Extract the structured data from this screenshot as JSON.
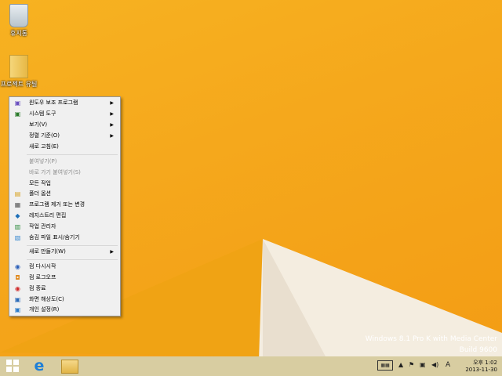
{
  "desktop": {
    "recycle_bin": "휴지통",
    "folder": "프로젝트 유틸"
  },
  "menu": {
    "items": [
      {
        "label": "윈도우 보조 프로그램",
        "submenu": true,
        "disabled": false,
        "icon": "accessories-icon"
      },
      {
        "label": "시스템 도구",
        "submenu": true,
        "disabled": false,
        "icon": "system-tools-icon"
      },
      {
        "label": "보기(V)",
        "submenu": true,
        "disabled": false,
        "icon": ""
      },
      {
        "label": "정렬 기준(O)",
        "submenu": true,
        "disabled": false,
        "icon": ""
      },
      {
        "label": "새로 고침(E)",
        "submenu": false,
        "disabled": false,
        "icon": ""
      },
      {
        "label": "붙여넣기(P)",
        "submenu": false,
        "disabled": true,
        "icon": ""
      },
      {
        "label": "바로 가기 붙여넣기(S)",
        "submenu": false,
        "disabled": true,
        "icon": ""
      },
      {
        "label": "모든 작업",
        "submenu": false,
        "disabled": false,
        "icon": ""
      },
      {
        "label": "폴더 옵션",
        "submenu": false,
        "disabled": false,
        "icon": "folder-options-icon"
      },
      {
        "label": "프로그램 제거 또는 변경",
        "submenu": false,
        "disabled": false,
        "icon": "programs-icon"
      },
      {
        "label": "레지스트리 편집",
        "submenu": false,
        "disabled": false,
        "icon": "registry-icon"
      },
      {
        "label": "작업 관리자",
        "submenu": false,
        "disabled": false,
        "icon": "task-manager-icon"
      },
      {
        "label": "숨김 파일 표시/숨기기",
        "submenu": false,
        "disabled": false,
        "icon": "hidden-files-icon"
      },
      {
        "label": "새로 만들기(W)",
        "submenu": true,
        "disabled": false,
        "icon": ""
      },
      {
        "label": "컴 다시시작",
        "submenu": false,
        "disabled": false,
        "icon": "restart-icon"
      },
      {
        "label": "컴 로그오프",
        "submenu": false,
        "disabled": false,
        "icon": "logoff-icon"
      },
      {
        "label": "컴 종료",
        "submenu": false,
        "disabled": false,
        "icon": "shutdown-icon"
      },
      {
        "label": "화면 해상도(C)",
        "submenu": false,
        "disabled": false,
        "icon": "resolution-icon"
      },
      {
        "label": "개인 설정(R)",
        "submenu": false,
        "disabled": false,
        "icon": "personalize-icon"
      }
    ]
  },
  "watermark": {
    "line1": "Windows 8.1 Pro K with Media Center",
    "line2": "Build 9600"
  },
  "clock": {
    "time": "오후 1:02",
    "date": "2013-11-30"
  },
  "tray": {
    "ime": "A"
  },
  "colors": {
    "wallpaper": "#f5a81c",
    "taskbar": "#d8cda1"
  }
}
